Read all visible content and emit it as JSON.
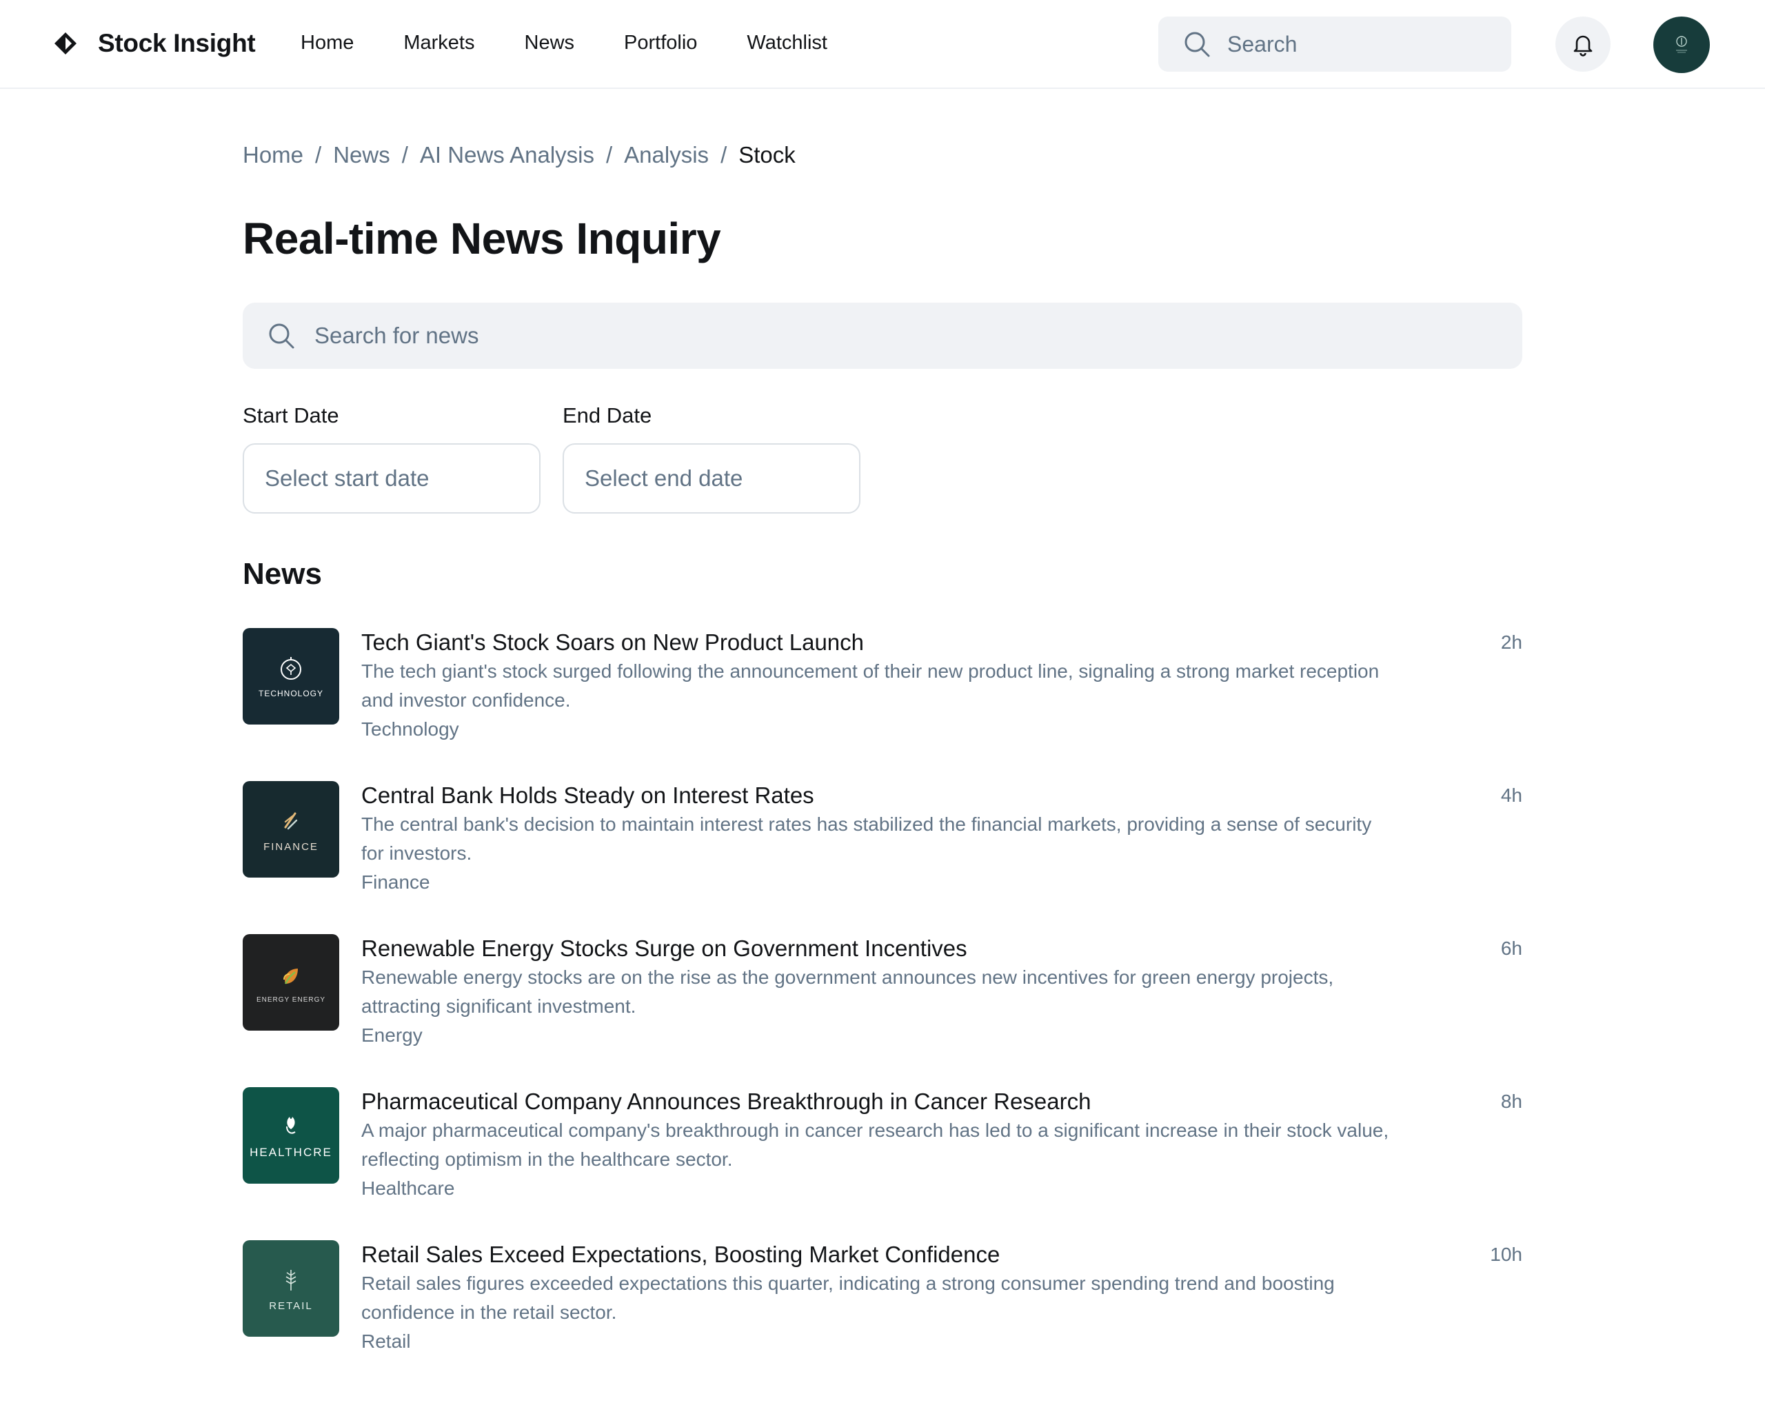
{
  "header": {
    "brand": "Stock Insight",
    "nav": [
      "Home",
      "Markets",
      "News",
      "Portfolio",
      "Watchlist"
    ],
    "search_placeholder": "Search"
  },
  "breadcrumb": [
    "Home",
    "News",
    "AI News Analysis",
    "Analysis",
    "Stock"
  ],
  "page_title": "Real-time News Inquiry",
  "news_search_placeholder": "Search for news",
  "dates": {
    "start_label": "Start Date",
    "start_placeholder": "Select start date",
    "end_label": "End Date",
    "end_placeholder": "Select end date"
  },
  "section_title": "News",
  "news": [
    {
      "title": "Tech Giant's Stock Soars on New Product Launch",
      "description": "The tech giant's stock surged following the announcement of their new product line, signaling a strong market reception and investor confidence.",
      "category": "Technology",
      "time": "2h",
      "thumb_label": "TECHNOLOGY",
      "thumb_color": "#172a33"
    },
    {
      "title": "Central Bank Holds Steady on Interest Rates",
      "description": "The central bank's decision to maintain interest rates has stabilized the financial markets, providing a sense of security for investors.",
      "category": "Finance",
      "time": "4h",
      "thumb_label": "FINANCE",
      "thumb_color": "#172a2f"
    },
    {
      "title": "Renewable Energy Stocks Surge on Government Incentives",
      "description": "Renewable energy stocks are on the rise as the government announces new incentives for green energy projects, attracting significant investment.",
      "category": "Energy",
      "time": "6h",
      "thumb_label": "ENERGY ENERGY",
      "thumb_color": "#202122"
    },
    {
      "title": "Pharmaceutical Company Announces Breakthrough in Cancer Research",
      "description": "A major pharmaceutical company's breakthrough in cancer research has led to a significant increase in their stock value, reflecting optimism in the healthcare sector.",
      "category": "Healthcare",
      "time": "8h",
      "thumb_label": "HEALTHCRE",
      "thumb_color": "#0e5447"
    },
    {
      "title": "Retail Sales Exceed Expectations, Boosting Market Confidence",
      "description": "Retail sales figures exceeded expectations this quarter, indicating a strong consumer spending trend and boosting confidence in the retail sector.",
      "category": "Retail",
      "time": "10h",
      "thumb_label": "RETAIL",
      "thumb_color": "#275a4e"
    }
  ]
}
